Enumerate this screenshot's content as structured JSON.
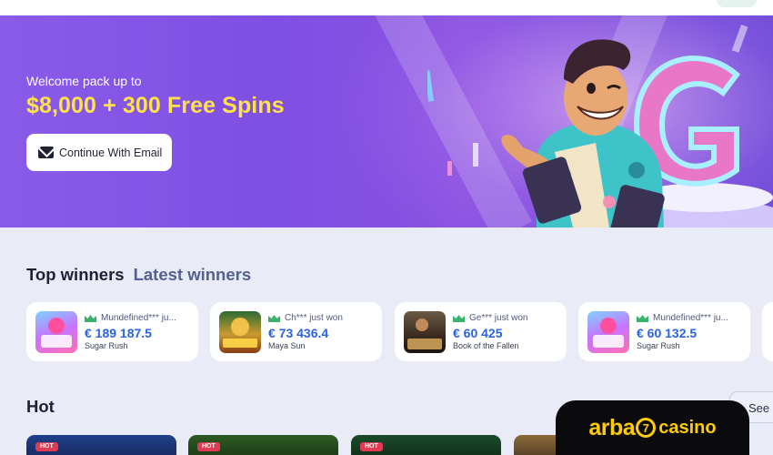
{
  "hero": {
    "subtitle": "Welcome pack up to",
    "title": "$8,000 + 300 Free Spins",
    "cta_label": "Continue With Email"
  },
  "winners_section": {
    "tab_top": "Top winners",
    "tab_latest": "Latest winners",
    "items": [
      {
        "user": "Mundefined*** ju...",
        "amount": "€ 189 187.5",
        "game": "Sugar Rush"
      },
      {
        "user": "Ch*** just won",
        "amount": "€ 73 436.4",
        "game": "Maya Sun"
      },
      {
        "user": "Ge*** just won",
        "amount": "€ 60 425",
        "game": "Book of the Fallen"
      },
      {
        "user": "Mundefined*** ju...",
        "amount": "€ 60 132.5",
        "game": "Sugar Rush"
      }
    ]
  },
  "hot_section": {
    "title": "Hot",
    "see_all": "See",
    "tag": "HOT"
  },
  "logo": {
    "part1": "arba",
    "part2": "7",
    "part3": "casino"
  },
  "colors": {
    "accent_yellow": "#ffe14a",
    "amount_blue": "#2a63df",
    "hero_purple": "#8a5be8",
    "brand_yellow": "#ffcb05"
  }
}
